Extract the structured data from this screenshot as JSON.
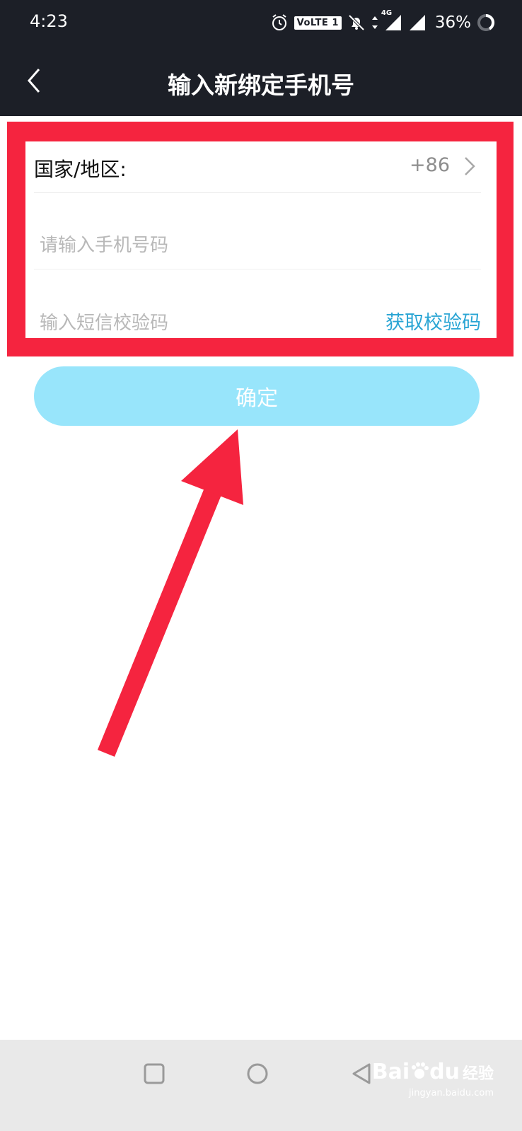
{
  "status_bar": {
    "time": "4:23",
    "volte_label": "VoLTE 1",
    "network_label": "4G",
    "battery": "36%",
    "icons": [
      "alarm-icon",
      "volte-icon",
      "bell-off-icon",
      "data-arrows-icon",
      "signal-icon",
      "signal-icon",
      "battery-ring-icon"
    ]
  },
  "header": {
    "title": "输入新绑定手机号",
    "back_icon": "chevron-left-icon"
  },
  "form": {
    "country_label": "国家/地区:",
    "country_code": "+86",
    "phone_placeholder": "请输入手机号码",
    "code_placeholder": "输入短信校验码",
    "get_code_label": "获取校验码"
  },
  "confirm_label": "确定",
  "nav_bar": {
    "icons": [
      "square-icon",
      "circle-icon",
      "triangle-back-icon"
    ]
  },
  "watermark": {
    "brand": "Bai",
    "brand_mid": "du",
    "suffix": "经验",
    "url": "jingyan.baidu.com"
  },
  "colors": {
    "header_bg": "#1c1f27",
    "highlight_red": "#f5243f",
    "button_bg": "#98e5fb",
    "link_blue": "#2aa5d4"
  }
}
